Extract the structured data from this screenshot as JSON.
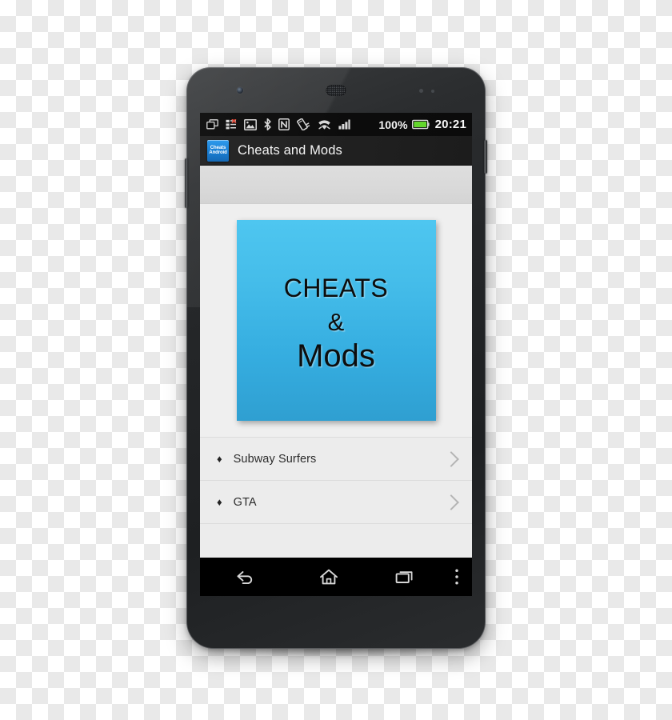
{
  "device": {
    "name": "android-smartphone-mockup",
    "hardware": {
      "front_camera": "front-camera",
      "earpiece": "earpiece-speaker",
      "sensors": "proximity-sensor",
      "power_button": "power-button",
      "volume_button": "volume-rocker"
    }
  },
  "status_bar": {
    "icons": [
      {
        "name": "screen-cast-icon"
      },
      {
        "name": "sync-error-icon"
      },
      {
        "name": "image-download-icon"
      },
      {
        "name": "bluetooth-icon"
      },
      {
        "name": "nfc-icon"
      },
      {
        "name": "vibrate-icon"
      },
      {
        "name": "wifi-icon"
      },
      {
        "name": "cellular-signal-icon"
      }
    ],
    "battery_percent": "100%",
    "battery_icon": "battery-full-icon",
    "clock": "20:21"
  },
  "action_bar": {
    "app_icon": {
      "name": "cheats-android-app-icon",
      "line1": "Cheats",
      "line2": "Android",
      "color": "#1a7fd4"
    },
    "title": "Cheats and Mods"
  },
  "ad_banner": {
    "name": "ad-banner-placeholder",
    "text": ""
  },
  "splash": {
    "name": "cheats-and-mods-splash-image",
    "line_cheats": "Cheats",
    "line_amp": "&",
    "line_mods": "Mods",
    "color_top": "#4ec6f0",
    "color_bottom": "#2f9fd1"
  },
  "game_list": {
    "bullet": "♦",
    "items": [
      {
        "label": "Subway Surfers"
      },
      {
        "label": "GTA"
      },
      {
        "label": ""
      }
    ]
  },
  "nav_bar": {
    "buttons": [
      {
        "name": "back-button"
      },
      {
        "name": "home-button"
      },
      {
        "name": "recents-button"
      },
      {
        "name": "overflow-menu-button"
      }
    ]
  }
}
